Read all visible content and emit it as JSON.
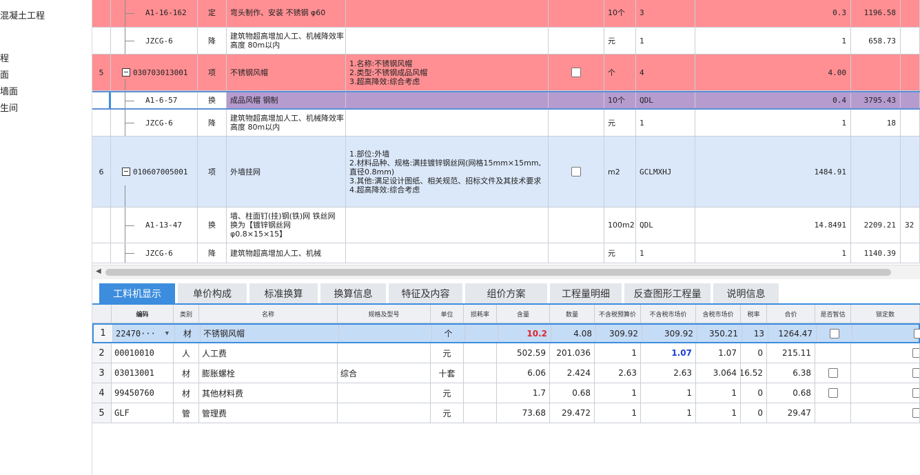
{
  "left_tree": [
    "混凝土工程",
    "程",
    "面",
    "墙面",
    "生间"
  ],
  "upper_rows": [
    {
      "style": "red",
      "idx": "",
      "code": "A1-16-162",
      "type": "定",
      "name": "弯头制作、安装 不锈钢 φ60",
      "feature": "",
      "chk": false,
      "unit": "10个",
      "expr": "3",
      "qty": "0.3",
      "price": "1196.58"
    },
    {
      "style": "white",
      "idx": "",
      "code": "JZCG-6",
      "type": "降",
      "name": "建筑物超高增加人工、机械降效率 高度 80m以内",
      "feature": "",
      "chk": false,
      "unit": "元",
      "expr": "1",
      "qty": "1",
      "price": "658.73"
    },
    {
      "style": "red",
      "idx": "5",
      "code": "030703013001",
      "type": "项",
      "name": "不锈钢风帽",
      "feature": "1.名称:不锈钢风帽\n2.类型:不锈钢成品风帽\n3.超高降效:综合考虑",
      "chk": true,
      "unit": "个",
      "expr": "4",
      "qty": "4.00",
      "price": ""
    },
    {
      "style": "purple",
      "idx": "",
      "code": "A1-6-57",
      "type": "换",
      "name": "成品风帽 钢制",
      "feature": "",
      "chk": false,
      "unit": "10个",
      "expr": "QDL",
      "qty": "0.4",
      "price": "3795.43"
    },
    {
      "style": "white",
      "idx": "",
      "code": "JZCG-6",
      "type": "降",
      "name": "建筑物超高增加人工、机械降效率 高度 80m以内",
      "feature": "",
      "chk": false,
      "unit": "元",
      "expr": "1",
      "qty": "1",
      "price": "18"
    },
    {
      "style": "blue",
      "idx": "6",
      "code": "010607005001",
      "type": "项",
      "name": "外墙挂网",
      "feature": "1.部位:外墙\n2.材料品种、规格:满挂镀锌钢丝网(网格15mm×15mm,直径0.8mm)\n3.其他:满足设计图纸、相关规范、招标文件及其技术要求\n4.超高降效:综合考虑",
      "chk": true,
      "unit": "m2",
      "expr": "GCLMXHJ",
      "qty": "1484.91",
      "price": ""
    },
    {
      "style": "white",
      "idx": "",
      "code": "A1-13-47",
      "type": "换",
      "name": "墙、柱面钉(挂)钢(铁)网 铁丝网 换为【镀锌钢丝网 φ0.8×15×15】",
      "feature": "",
      "chk": false,
      "unit": "100m2",
      "expr": "QDL",
      "qty": "14.8491",
      "price": "2209.21",
      "extra": "32"
    },
    {
      "style": "white",
      "idx": "",
      "code": "JZCG-6",
      "type": "降",
      "name": "建筑物超高增加人工、机械",
      "feature": "",
      "chk": false,
      "unit": "元",
      "expr": "1",
      "qty": "1",
      "price": "1140.39"
    }
  ],
  "tabs": [
    "工料机显示",
    "单价构成",
    "标准换算",
    "换算信息",
    "特征及内容",
    "组价方案",
    "工程量明细",
    "反查图形工程量",
    "说明信息"
  ],
  "lower_headers": [
    "编码",
    "类别",
    "名称",
    "规格及型号",
    "单位",
    "损耗率",
    "含量",
    "数量",
    "不含税预算价",
    "不含税市场价",
    "含税市场价",
    "税率",
    "合价",
    "是否暂估",
    "锁定数"
  ],
  "lower_rows": [
    {
      "idx": "1",
      "code": "22470···",
      "cat": "材",
      "name": "不锈钢风帽",
      "spec": "",
      "unit": "个",
      "loss": "",
      "content": "10.2",
      "qty": "4.08",
      "budget": "309.92",
      "market": "309.92",
      "taxmarket": "350.21",
      "rate": "13",
      "total": "1264.47",
      "est": true
    },
    {
      "idx": "2",
      "code": "00010010",
      "cat": "人",
      "name": "人工费",
      "spec": "",
      "unit": "元",
      "loss": "",
      "content": "502.59",
      "qty": "201.036",
      "budget": "1",
      "market": "1.07",
      "taxmarket": "1.07",
      "rate": "0",
      "total": "215.11",
      "est": false
    },
    {
      "idx": "3",
      "code": "03013001",
      "cat": "材",
      "name": "膨胀螺栓",
      "spec": "综合",
      "unit": "十套",
      "loss": "",
      "content": "6.06",
      "qty": "2.424",
      "budget": "2.63",
      "market": "2.63",
      "taxmarket": "3.064",
      "rate": "16.52",
      "total": "6.38",
      "est": true
    },
    {
      "idx": "4",
      "code": "99450760",
      "cat": "材",
      "name": "其他材料费",
      "spec": "",
      "unit": "元",
      "loss": "",
      "content": "1.7",
      "qty": "0.68",
      "budget": "1",
      "market": "1",
      "taxmarket": "1",
      "rate": "0",
      "total": "0.68",
      "est": true
    },
    {
      "idx": "5",
      "code": "GLF",
      "cat": "管",
      "name": "管理费",
      "spec": "",
      "unit": "元",
      "loss": "",
      "content": "73.68",
      "qty": "29.472",
      "budget": "1",
      "market": "1",
      "taxmarket": "1",
      "rate": "0",
      "total": "29.47",
      "est": false
    }
  ],
  "colors": {
    "accent": "#3c8dde",
    "row_red": "#ff8f93",
    "row_blue": "#dbe8fa",
    "row_purple": "#b69bcf"
  }
}
